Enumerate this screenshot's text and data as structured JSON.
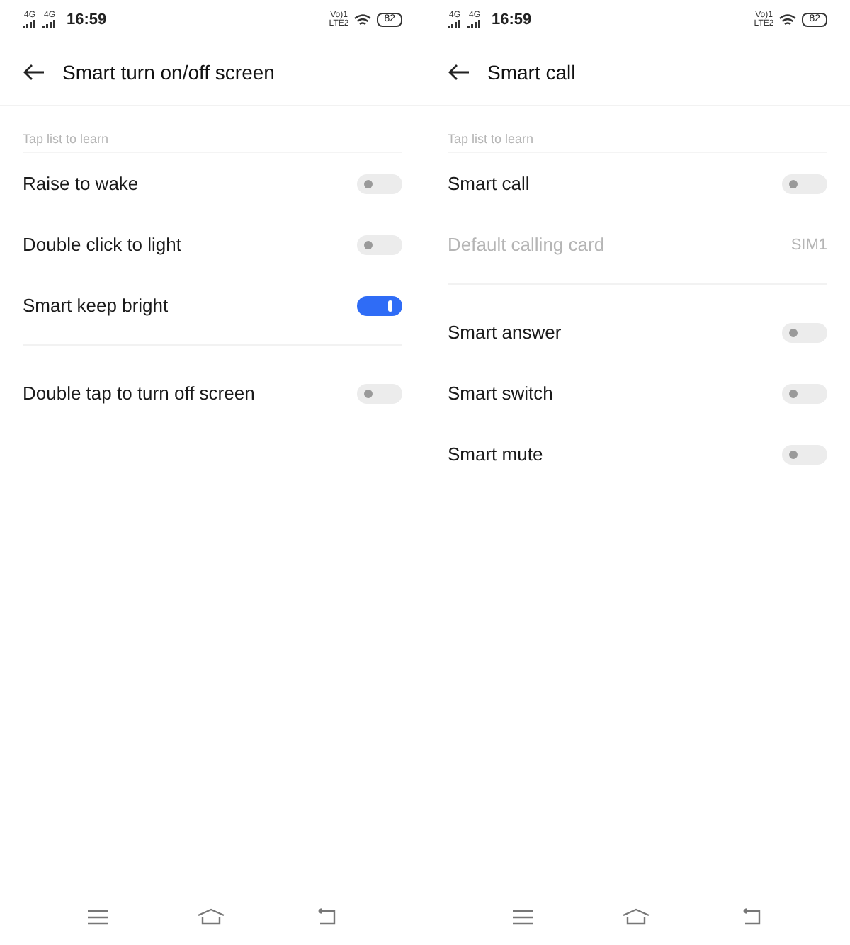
{
  "screens": [
    {
      "status_bar": {
        "signal_labels": [
          "4G",
          "4G"
        ],
        "time": "16:59",
        "volte": [
          "Vo)1",
          "LTE2"
        ],
        "battery": "82"
      },
      "title": "Smart turn on/off screen",
      "sections": [
        {
          "header": "Tap list to learn",
          "items": [
            {
              "kind": "toggle",
              "label": "Raise to wake",
              "on": false
            },
            {
              "kind": "toggle",
              "label": "Double click to light",
              "on": false
            },
            {
              "kind": "toggle",
              "label": "Smart keep bright",
              "on": true
            }
          ]
        },
        {
          "items": [
            {
              "kind": "toggle",
              "label": "Double tap to turn off screen",
              "on": false
            }
          ]
        }
      ]
    },
    {
      "status_bar": {
        "signal_labels": [
          "4G",
          "4G"
        ],
        "time": "16:59",
        "volte": [
          "Vo)1",
          "LTE2"
        ],
        "battery": "82"
      },
      "title": "Smart call",
      "sections": [
        {
          "header": "Tap list to learn",
          "items": [
            {
              "kind": "toggle",
              "label": "Smart call",
              "on": false
            },
            {
              "kind": "value",
              "label": "Default calling card",
              "value": "SIM1",
              "disabled": true
            }
          ]
        },
        {
          "items": [
            {
              "kind": "toggle",
              "label": "Smart answer",
              "on": false
            },
            {
              "kind": "toggle",
              "label": "Smart switch",
              "on": false
            },
            {
              "kind": "toggle",
              "label": "Smart mute",
              "on": false
            }
          ]
        }
      ]
    }
  ]
}
